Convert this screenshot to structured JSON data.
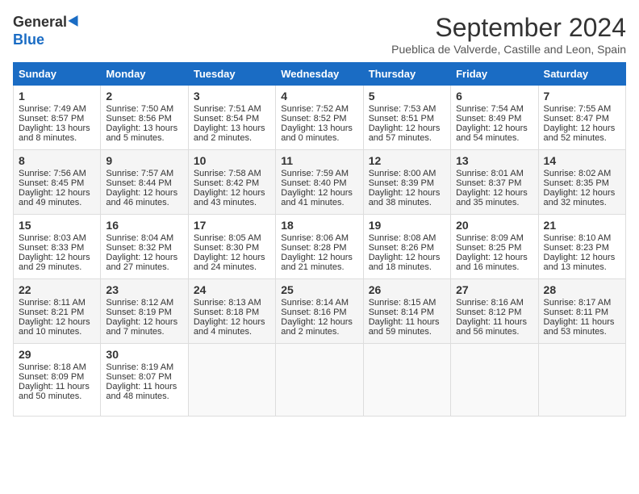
{
  "logo": {
    "general": "General",
    "blue": "Blue"
  },
  "title": "September 2024",
  "location": "Pueblica de Valverde, Castille and Leon, Spain",
  "days": [
    "Sunday",
    "Monday",
    "Tuesday",
    "Wednesday",
    "Thursday",
    "Friday",
    "Saturday"
  ],
  "weeks": [
    [
      {
        "day": "1",
        "sunrise": "Sunrise: 7:49 AM",
        "sunset": "Sunset: 8:57 PM",
        "daylight": "Daylight: 13 hours and 8 minutes."
      },
      {
        "day": "2",
        "sunrise": "Sunrise: 7:50 AM",
        "sunset": "Sunset: 8:56 PM",
        "daylight": "Daylight: 13 hours and 5 minutes."
      },
      {
        "day": "3",
        "sunrise": "Sunrise: 7:51 AM",
        "sunset": "Sunset: 8:54 PM",
        "daylight": "Daylight: 13 hours and 2 minutes."
      },
      {
        "day": "4",
        "sunrise": "Sunrise: 7:52 AM",
        "sunset": "Sunset: 8:52 PM",
        "daylight": "Daylight: 13 hours and 0 minutes."
      },
      {
        "day": "5",
        "sunrise": "Sunrise: 7:53 AM",
        "sunset": "Sunset: 8:51 PM",
        "daylight": "Daylight: 12 hours and 57 minutes."
      },
      {
        "day": "6",
        "sunrise": "Sunrise: 7:54 AM",
        "sunset": "Sunset: 8:49 PM",
        "daylight": "Daylight: 12 hours and 54 minutes."
      },
      {
        "day": "7",
        "sunrise": "Sunrise: 7:55 AM",
        "sunset": "Sunset: 8:47 PM",
        "daylight": "Daylight: 12 hours and 52 minutes."
      }
    ],
    [
      {
        "day": "8",
        "sunrise": "Sunrise: 7:56 AM",
        "sunset": "Sunset: 8:45 PM",
        "daylight": "Daylight: 12 hours and 49 minutes."
      },
      {
        "day": "9",
        "sunrise": "Sunrise: 7:57 AM",
        "sunset": "Sunset: 8:44 PM",
        "daylight": "Daylight: 12 hours and 46 minutes."
      },
      {
        "day": "10",
        "sunrise": "Sunrise: 7:58 AM",
        "sunset": "Sunset: 8:42 PM",
        "daylight": "Daylight: 12 hours and 43 minutes."
      },
      {
        "day": "11",
        "sunrise": "Sunrise: 7:59 AM",
        "sunset": "Sunset: 8:40 PM",
        "daylight": "Daylight: 12 hours and 41 minutes."
      },
      {
        "day": "12",
        "sunrise": "Sunrise: 8:00 AM",
        "sunset": "Sunset: 8:39 PM",
        "daylight": "Daylight: 12 hours and 38 minutes."
      },
      {
        "day": "13",
        "sunrise": "Sunrise: 8:01 AM",
        "sunset": "Sunset: 8:37 PM",
        "daylight": "Daylight: 12 hours and 35 minutes."
      },
      {
        "day": "14",
        "sunrise": "Sunrise: 8:02 AM",
        "sunset": "Sunset: 8:35 PM",
        "daylight": "Daylight: 12 hours and 32 minutes."
      }
    ],
    [
      {
        "day": "15",
        "sunrise": "Sunrise: 8:03 AM",
        "sunset": "Sunset: 8:33 PM",
        "daylight": "Daylight: 12 hours and 29 minutes."
      },
      {
        "day": "16",
        "sunrise": "Sunrise: 8:04 AM",
        "sunset": "Sunset: 8:32 PM",
        "daylight": "Daylight: 12 hours and 27 minutes."
      },
      {
        "day": "17",
        "sunrise": "Sunrise: 8:05 AM",
        "sunset": "Sunset: 8:30 PM",
        "daylight": "Daylight: 12 hours and 24 minutes."
      },
      {
        "day": "18",
        "sunrise": "Sunrise: 8:06 AM",
        "sunset": "Sunset: 8:28 PM",
        "daylight": "Daylight: 12 hours and 21 minutes."
      },
      {
        "day": "19",
        "sunrise": "Sunrise: 8:08 AM",
        "sunset": "Sunset: 8:26 PM",
        "daylight": "Daylight: 12 hours and 18 minutes."
      },
      {
        "day": "20",
        "sunrise": "Sunrise: 8:09 AM",
        "sunset": "Sunset: 8:25 PM",
        "daylight": "Daylight: 12 hours and 16 minutes."
      },
      {
        "day": "21",
        "sunrise": "Sunrise: 8:10 AM",
        "sunset": "Sunset: 8:23 PM",
        "daylight": "Daylight: 12 hours and 13 minutes."
      }
    ],
    [
      {
        "day": "22",
        "sunrise": "Sunrise: 8:11 AM",
        "sunset": "Sunset: 8:21 PM",
        "daylight": "Daylight: 12 hours and 10 minutes."
      },
      {
        "day": "23",
        "sunrise": "Sunrise: 8:12 AM",
        "sunset": "Sunset: 8:19 PM",
        "daylight": "Daylight: 12 hours and 7 minutes."
      },
      {
        "day": "24",
        "sunrise": "Sunrise: 8:13 AM",
        "sunset": "Sunset: 8:18 PM",
        "daylight": "Daylight: 12 hours and 4 minutes."
      },
      {
        "day": "25",
        "sunrise": "Sunrise: 8:14 AM",
        "sunset": "Sunset: 8:16 PM",
        "daylight": "Daylight: 12 hours and 2 minutes."
      },
      {
        "day": "26",
        "sunrise": "Sunrise: 8:15 AM",
        "sunset": "Sunset: 8:14 PM",
        "daylight": "Daylight: 11 hours and 59 minutes."
      },
      {
        "day": "27",
        "sunrise": "Sunrise: 8:16 AM",
        "sunset": "Sunset: 8:12 PM",
        "daylight": "Daylight: 11 hours and 56 minutes."
      },
      {
        "day": "28",
        "sunrise": "Sunrise: 8:17 AM",
        "sunset": "Sunset: 8:11 PM",
        "daylight": "Daylight: 11 hours and 53 minutes."
      }
    ],
    [
      {
        "day": "29",
        "sunrise": "Sunrise: 8:18 AM",
        "sunset": "Sunset: 8:09 PM",
        "daylight": "Daylight: 11 hours and 50 minutes."
      },
      {
        "day": "30",
        "sunrise": "Sunrise: 8:19 AM",
        "sunset": "Sunset: 8:07 PM",
        "daylight": "Daylight: 11 hours and 48 minutes."
      },
      null,
      null,
      null,
      null,
      null
    ]
  ]
}
